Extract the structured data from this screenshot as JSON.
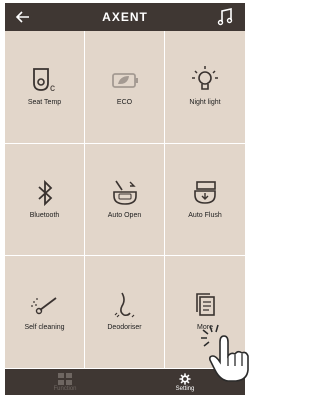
{
  "header": {
    "title": "AXENT",
    "back_icon": "back-arrow-icon",
    "music_icon": "music-note-icon"
  },
  "tiles": [
    {
      "label": "Seat Temp",
      "icon": "seat-temp-icon"
    },
    {
      "label": "ECO",
      "icon": "eco-leaf-icon"
    },
    {
      "label": "Night light",
      "icon": "night-light-icon"
    },
    {
      "label": "Bluetooth",
      "icon": "bluetooth-icon"
    },
    {
      "label": "Auto Open",
      "icon": "auto-open-icon"
    },
    {
      "label": "Auto Flush",
      "icon": "auto-flush-icon"
    },
    {
      "label": "Self cleaning",
      "icon": "self-cleaning-icon"
    },
    {
      "label": "Deodoriser",
      "icon": "deodoriser-icon"
    },
    {
      "label": "More",
      "icon": "more-icon"
    }
  ],
  "tabs": [
    {
      "label": "Function",
      "icon": "grid-icon",
      "active": false
    },
    {
      "label": "Setting",
      "icon": "gear-icon",
      "active": true
    }
  ],
  "colors": {
    "bar": "#3f3733",
    "tile": "#e2d6ca",
    "icon": "#3a3330"
  }
}
